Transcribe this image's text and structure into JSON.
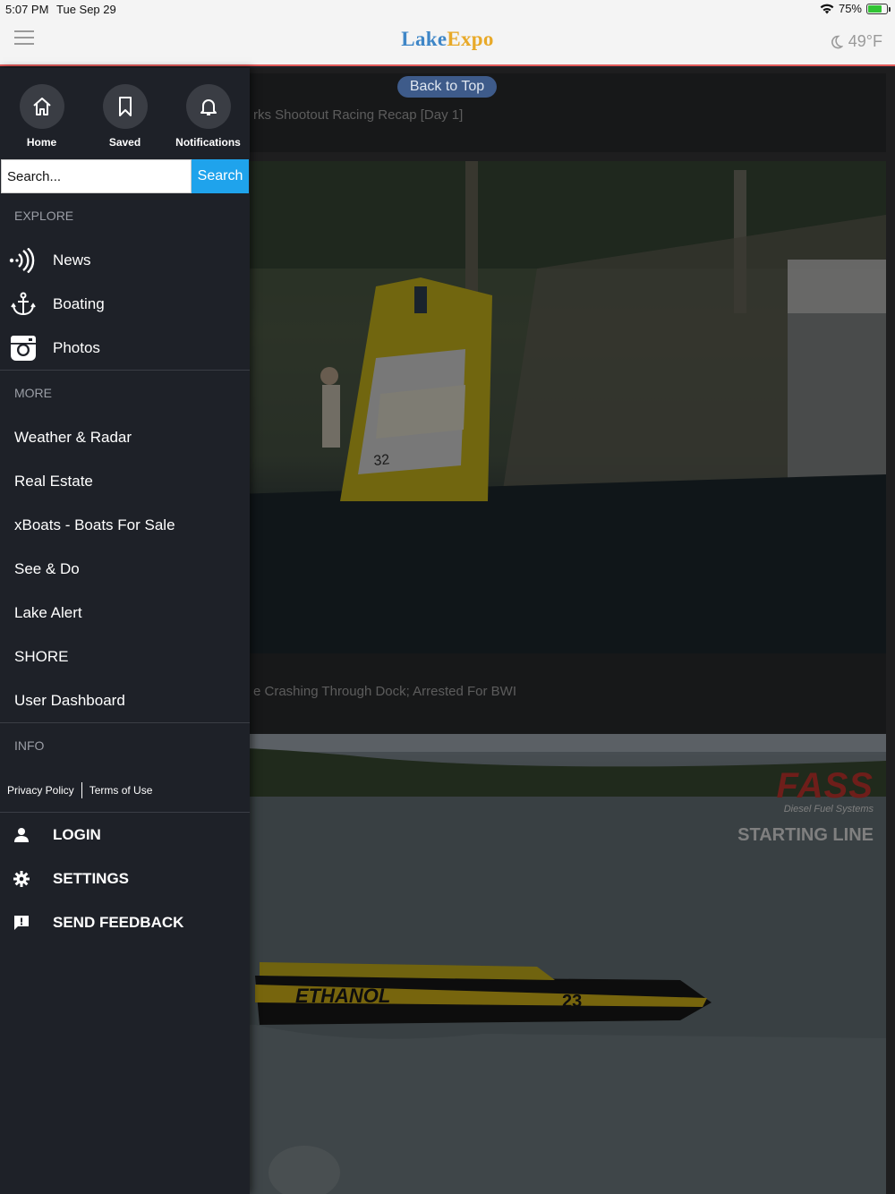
{
  "status_bar": {
    "time": "5:07 PM",
    "date": "Tue Sep 29",
    "battery": "75%",
    "battery_level": 0.75
  },
  "header": {
    "logo_part1": "Lake",
    "logo_part2": "Expo",
    "temperature": "49°F"
  },
  "content": {
    "back_to_top": "Back to Top",
    "card1_title": "rks Shootout Racing Recap [Day 1]",
    "card2_title": "e Crashing Through Dock; Arrested For BWI",
    "overlay_brand": "FASS",
    "overlay_sub": "Diesel Fuel Systems",
    "overlay_caption": "STARTING LINE",
    "boat_number": "32",
    "boat_text": "ETHANOL",
    "boat2_number": "23"
  },
  "drawer": {
    "quick": [
      {
        "label": "Home",
        "icon": "home-icon"
      },
      {
        "label": "Saved",
        "icon": "bookmark-icon"
      },
      {
        "label": "Notifications",
        "icon": "bell-icon"
      }
    ],
    "search": {
      "placeholder": "Search...",
      "button": "Search"
    },
    "explore_header": "EXPLORE",
    "explore": [
      {
        "label": "News",
        "icon": "broadcast-icon"
      },
      {
        "label": "Boating",
        "icon": "anchor-icon"
      },
      {
        "label": "Photos",
        "icon": "camera-icon"
      }
    ],
    "more_header": "MORE",
    "more": [
      "Weather & Radar",
      "Real Estate",
      "xBoats - Boats For Sale",
      "See & Do",
      "Lake Alert",
      "SHORE",
      "User Dashboard"
    ],
    "info_header": "INFO",
    "privacy": "Privacy Policy",
    "terms": "Terms of Use",
    "actions": [
      {
        "label": "LOGIN",
        "icon": "user-icon"
      },
      {
        "label": "SETTINGS",
        "icon": "gear-icon"
      },
      {
        "label": "SEND FEEDBACK",
        "icon": "feedback-icon"
      }
    ]
  }
}
